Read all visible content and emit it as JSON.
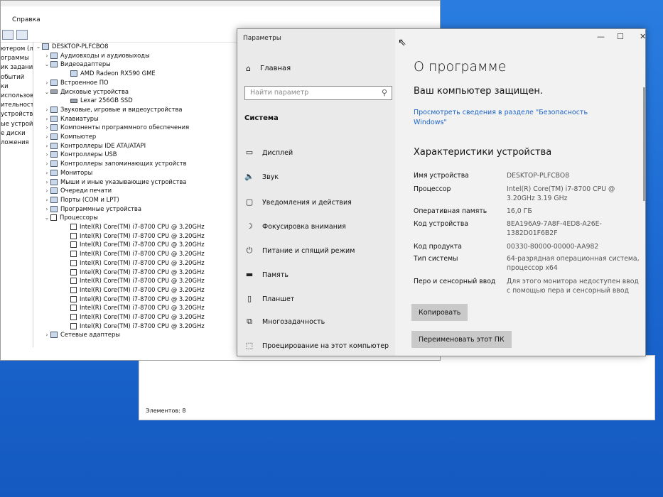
{
  "devmgr": {
    "menu": [
      "Справка"
    ],
    "left_items": [
      "ютером (л",
      "ограммы",
      "ик заданий",
      "обытий",
      "ки",
      "использовате",
      "ительность",
      "устройства",
      "ые устройств",
      "е диски",
      "ложения"
    ],
    "root": "DESKTOP-PLFCBO8",
    "tree": [
      {
        "label": "Аудиовходы и аудиовыходы",
        "level": 1,
        "chev": "›",
        "icon": "speaker-icon"
      },
      {
        "label": "Видеоадаптеры",
        "level": 1,
        "chev": "⌄",
        "icon": "display-adapter-icon"
      },
      {
        "label": "AMD Radeon RX590 GME",
        "level": 2,
        "chev": "",
        "icon": "display-adapter-icon"
      },
      {
        "label": "Встроенное ПО",
        "level": 1,
        "chev": "›",
        "icon": "firmware-icon"
      },
      {
        "label": "Дисковые устройства",
        "level": 1,
        "chev": "⌄",
        "icon": "disk-icon"
      },
      {
        "label": "Lexar 256GB SSD",
        "level": 2,
        "chev": "",
        "icon": "disk-icon"
      },
      {
        "label": "Звуковые, игровые и видеоустройства",
        "level": 1,
        "chev": "›",
        "icon": "sound-icon"
      },
      {
        "label": "Клавиатуры",
        "level": 1,
        "chev": "›",
        "icon": "keyboard-icon"
      },
      {
        "label": "Компоненты программного обеспечения",
        "level": 1,
        "chev": "›",
        "icon": "software-icon"
      },
      {
        "label": "Компьютер",
        "level": 1,
        "chev": "›",
        "icon": "computer-icon"
      },
      {
        "label": "Контроллеры IDE ATA/ATAPI",
        "level": 1,
        "chev": "›",
        "icon": "ide-icon"
      },
      {
        "label": "Контроллеры USB",
        "level": 1,
        "chev": "›",
        "icon": "usb-icon"
      },
      {
        "label": "Контроллеры запоминающих устройств",
        "level": 1,
        "chev": "›",
        "icon": "storage-icon"
      },
      {
        "label": "Мониторы",
        "level": 1,
        "chev": "›",
        "icon": "monitor-icon"
      },
      {
        "label": "Мыши и иные указывающие устройства",
        "level": 1,
        "chev": "›",
        "icon": "mouse-icon"
      },
      {
        "label": "Очереди печати",
        "level": 1,
        "chev": "›",
        "icon": "printer-icon"
      },
      {
        "label": "Порты (COM и LPT)",
        "level": 1,
        "chev": "›",
        "icon": "port-icon"
      },
      {
        "label": "Программные устройства",
        "level": 1,
        "chev": "›",
        "icon": "software-device-icon"
      },
      {
        "label": "Процессоры",
        "level": 1,
        "chev": "⌄",
        "icon": "cpu-icon"
      },
      {
        "label": "Intel(R) Core(TM) i7-8700 CPU @ 3.20GHz",
        "level": 2,
        "chev": "",
        "icon": "cpu-icon"
      },
      {
        "label": "Intel(R) Core(TM) i7-8700 CPU @ 3.20GHz",
        "level": 2,
        "chev": "",
        "icon": "cpu-icon"
      },
      {
        "label": "Intel(R) Core(TM) i7-8700 CPU @ 3.20GHz",
        "level": 2,
        "chev": "",
        "icon": "cpu-icon"
      },
      {
        "label": "Intel(R) Core(TM) i7-8700 CPU @ 3.20GHz",
        "level": 2,
        "chev": "",
        "icon": "cpu-icon"
      },
      {
        "label": "Intel(R) Core(TM) i7-8700 CPU @ 3.20GHz",
        "level": 2,
        "chev": "",
        "icon": "cpu-icon"
      },
      {
        "label": "Intel(R) Core(TM) i7-8700 CPU @ 3.20GHz",
        "level": 2,
        "chev": "",
        "icon": "cpu-icon"
      },
      {
        "label": "Intel(R) Core(TM) i7-8700 CPU @ 3.20GHz",
        "level": 2,
        "chev": "",
        "icon": "cpu-icon"
      },
      {
        "label": "Intel(R) Core(TM) i7-8700 CPU @ 3.20GHz",
        "level": 2,
        "chev": "",
        "icon": "cpu-icon"
      },
      {
        "label": "Intel(R) Core(TM) i7-8700 CPU @ 3.20GHz",
        "level": 2,
        "chev": "",
        "icon": "cpu-icon"
      },
      {
        "label": "Intel(R) Core(TM) i7-8700 CPU @ 3.20GHz",
        "level": 2,
        "chev": "",
        "icon": "cpu-icon"
      },
      {
        "label": "Intel(R) Core(TM) i7-8700 CPU @ 3.20GHz",
        "level": 2,
        "chev": "",
        "icon": "cpu-icon"
      },
      {
        "label": "Intel(R) Core(TM) i7-8700 CPU @ 3.20GHz",
        "level": 2,
        "chev": "",
        "icon": "cpu-icon"
      },
      {
        "label": "Сетевые адаптеры",
        "level": 1,
        "chev": "›",
        "icon": "network-icon"
      }
    ],
    "status": "Элементов: 8"
  },
  "settings": {
    "title": "Параметры",
    "home": "Главная",
    "search_placeholder": "Найти параметр",
    "section": "Система",
    "nav_items": [
      {
        "label": "Дисплей",
        "icon": "display-icon",
        "glyph": "▭"
      },
      {
        "label": "Звук",
        "icon": "sound-icon",
        "glyph": "🔈"
      },
      {
        "label": "Уведомления и действия",
        "icon": "notifications-icon",
        "glyph": "▢"
      },
      {
        "label": "Фокусировка внимания",
        "icon": "focus-assist-icon",
        "glyph": "☽"
      },
      {
        "label": "Питание и спящий режим",
        "icon": "power-icon",
        "glyph": "⏻"
      },
      {
        "label": "Память",
        "icon": "storage-icon",
        "glyph": "▬"
      },
      {
        "label": "Планшет",
        "icon": "tablet-icon",
        "glyph": "▯"
      },
      {
        "label": "Многозадачность",
        "icon": "multitasking-icon",
        "glyph": "⧉"
      },
      {
        "label": "Проецирование на этот компьютер",
        "icon": "projecting-icon",
        "glyph": "⬚"
      }
    ],
    "page_title": "О программе",
    "protected": "Ваш компьютер защищен.",
    "security_link": "Просмотреть сведения в разделе \"Безопасность Windows\"",
    "specs_title": "Характеристики устройства",
    "specs": [
      {
        "label": "Имя устройства",
        "value": "DESKTOP-PLFCBO8"
      },
      {
        "label": "Процессор",
        "value": "Intel(R) Core(TM) i7-8700 CPU @ 3.20GHz   3.19 GHz"
      },
      {
        "label": "Оперативная память",
        "value": "16,0 ГБ"
      },
      {
        "label": "Код устройства",
        "value": "8EA196A9-7A8F-4ED8-A26E-1382D01F6B2F"
      },
      {
        "label": "Код продукта",
        "value": "00330-80000-00000-AA982"
      },
      {
        "label": "Тип системы",
        "value": "64-разрядная операционная система, процессор x64"
      },
      {
        "label": "Перо и сенсорный ввод",
        "value": "Для этого монитора недоступен ввод с помощью пера и сенсорный ввод"
      }
    ],
    "copy_button": "Копировать",
    "rename_button": "Переименовать этот ПК"
  }
}
